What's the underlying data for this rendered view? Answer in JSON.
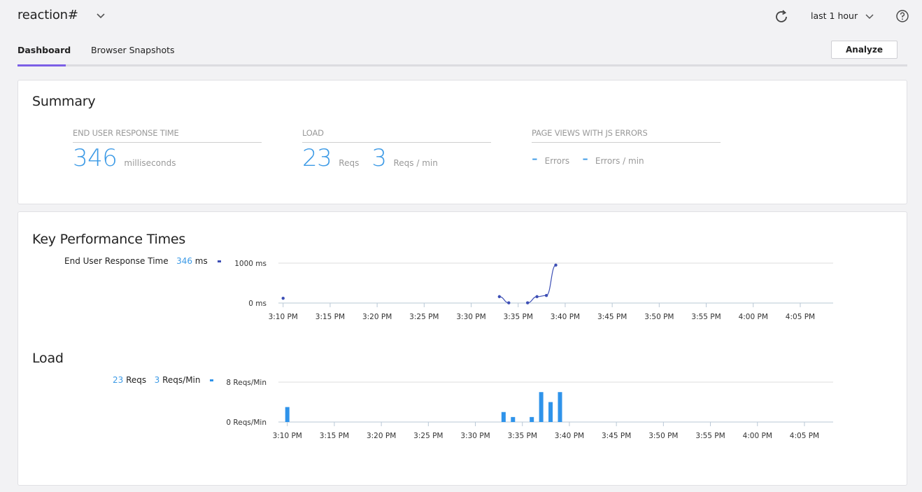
{
  "header": {
    "app_title": "reaction#",
    "app_dropdown_icon": "chevron-down-icon",
    "refresh_icon": "refresh-icon",
    "time_range": "last 1 hour",
    "time_range_icon": "chevron-down-icon",
    "help_icon": "help-circle-icon"
  },
  "tabs": [
    {
      "label": "Dashboard",
      "active": true
    },
    {
      "label": "Browser Snapshots",
      "active": false
    }
  ],
  "toolbar": {
    "analyze_label": "Analyze"
  },
  "colors": {
    "accent": "#7c5fe6",
    "value_blue": "#3c9ae6",
    "line_series": "#3d4fb5",
    "bar_series": "#2f93ea"
  },
  "summary": {
    "title": "Summary",
    "end_user_response_time": {
      "label": "END USER RESPONSE TIME",
      "value": "346",
      "unit": "milliseconds"
    },
    "load": {
      "label": "LOAD",
      "total_value": "23",
      "total_unit": "Reqs",
      "rate_value": "3",
      "rate_unit": "Reqs / min"
    },
    "js_errors": {
      "label": "PAGE VIEWS WITH JS ERRORS",
      "total_value": "-",
      "total_unit": "Errors",
      "rate_value": "-",
      "rate_unit": "Errors / min"
    }
  },
  "key_performance": {
    "title": "Key Performance Times",
    "legend_label": "End User Response Time",
    "legend_value": "346",
    "legend_unit": "ms"
  },
  "load_section": {
    "title": "Load",
    "legend_total_value": "23",
    "legend_total_unit": "Reqs",
    "legend_rate_value": "3",
    "legend_rate_unit": "Reqs/Min"
  },
  "chart_data": [
    {
      "type": "line",
      "title": "Key Performance Times",
      "series": [
        {
          "name": "End User Response Time",
          "segments": [
            [
              {
                "x": "3:10 PM",
                "y": 120
              }
            ],
            [
              {
                "x": "3:33 PM",
                "y": 160
              },
              {
                "x": "3:34 PM",
                "y": 5
              }
            ],
            [
              {
                "x": "3:36 PM",
                "y": 5
              },
              {
                "x": "3:37 PM",
                "y": 160
              },
              {
                "x": "3:38 PM",
                "y": 190
              },
              {
                "x": "3:39 PM",
                "y": 950
              }
            ]
          ]
        }
      ],
      "x_ticks": [
        "3:10 PM",
        "3:15 PM",
        "3:20 PM",
        "3:25 PM",
        "3:30 PM",
        "3:35 PM",
        "3:40 PM",
        "3:45 PM",
        "3:50 PM",
        "3:55 PM",
        "4:00 PM",
        "4:05 PM"
      ],
      "y_ticks": [
        "0 ms",
        "1000 ms"
      ],
      "ylim": [
        0,
        1000
      ],
      "xlim": [
        "3:09.5 PM",
        "4:08.5 PM"
      ],
      "xlabel": "",
      "ylabel": "",
      "grid": true
    },
    {
      "type": "bar",
      "title": "Load",
      "series": [
        {
          "name": "Reqs/Min",
          "points": [
            {
              "x": "3:10 PM",
              "y": 3
            },
            {
              "x": "3:33 PM",
              "y": 2
            },
            {
              "x": "3:34 PM",
              "y": 1
            },
            {
              "x": "3:36 PM",
              "y": 1
            },
            {
              "x": "3:37 PM",
              "y": 6
            },
            {
              "x": "3:38 PM",
              "y": 4
            },
            {
              "x": "3:39 PM",
              "y": 6
            }
          ]
        }
      ],
      "x_ticks": [
        "3:10 PM",
        "3:15 PM",
        "3:20 PM",
        "3:25 PM",
        "3:30 PM",
        "3:35 PM",
        "3:40 PM",
        "3:45 PM",
        "3:50 PM",
        "3:55 PM",
        "4:00 PM",
        "4:05 PM"
      ],
      "y_ticks": [
        "0 Reqs/Min",
        "8 Reqs/Min"
      ],
      "ylim": [
        0,
        8
      ],
      "xlim": [
        "3:09.5 PM",
        "4:08.5 PM"
      ],
      "xlabel": "",
      "ylabel": "",
      "grid": true
    }
  ]
}
